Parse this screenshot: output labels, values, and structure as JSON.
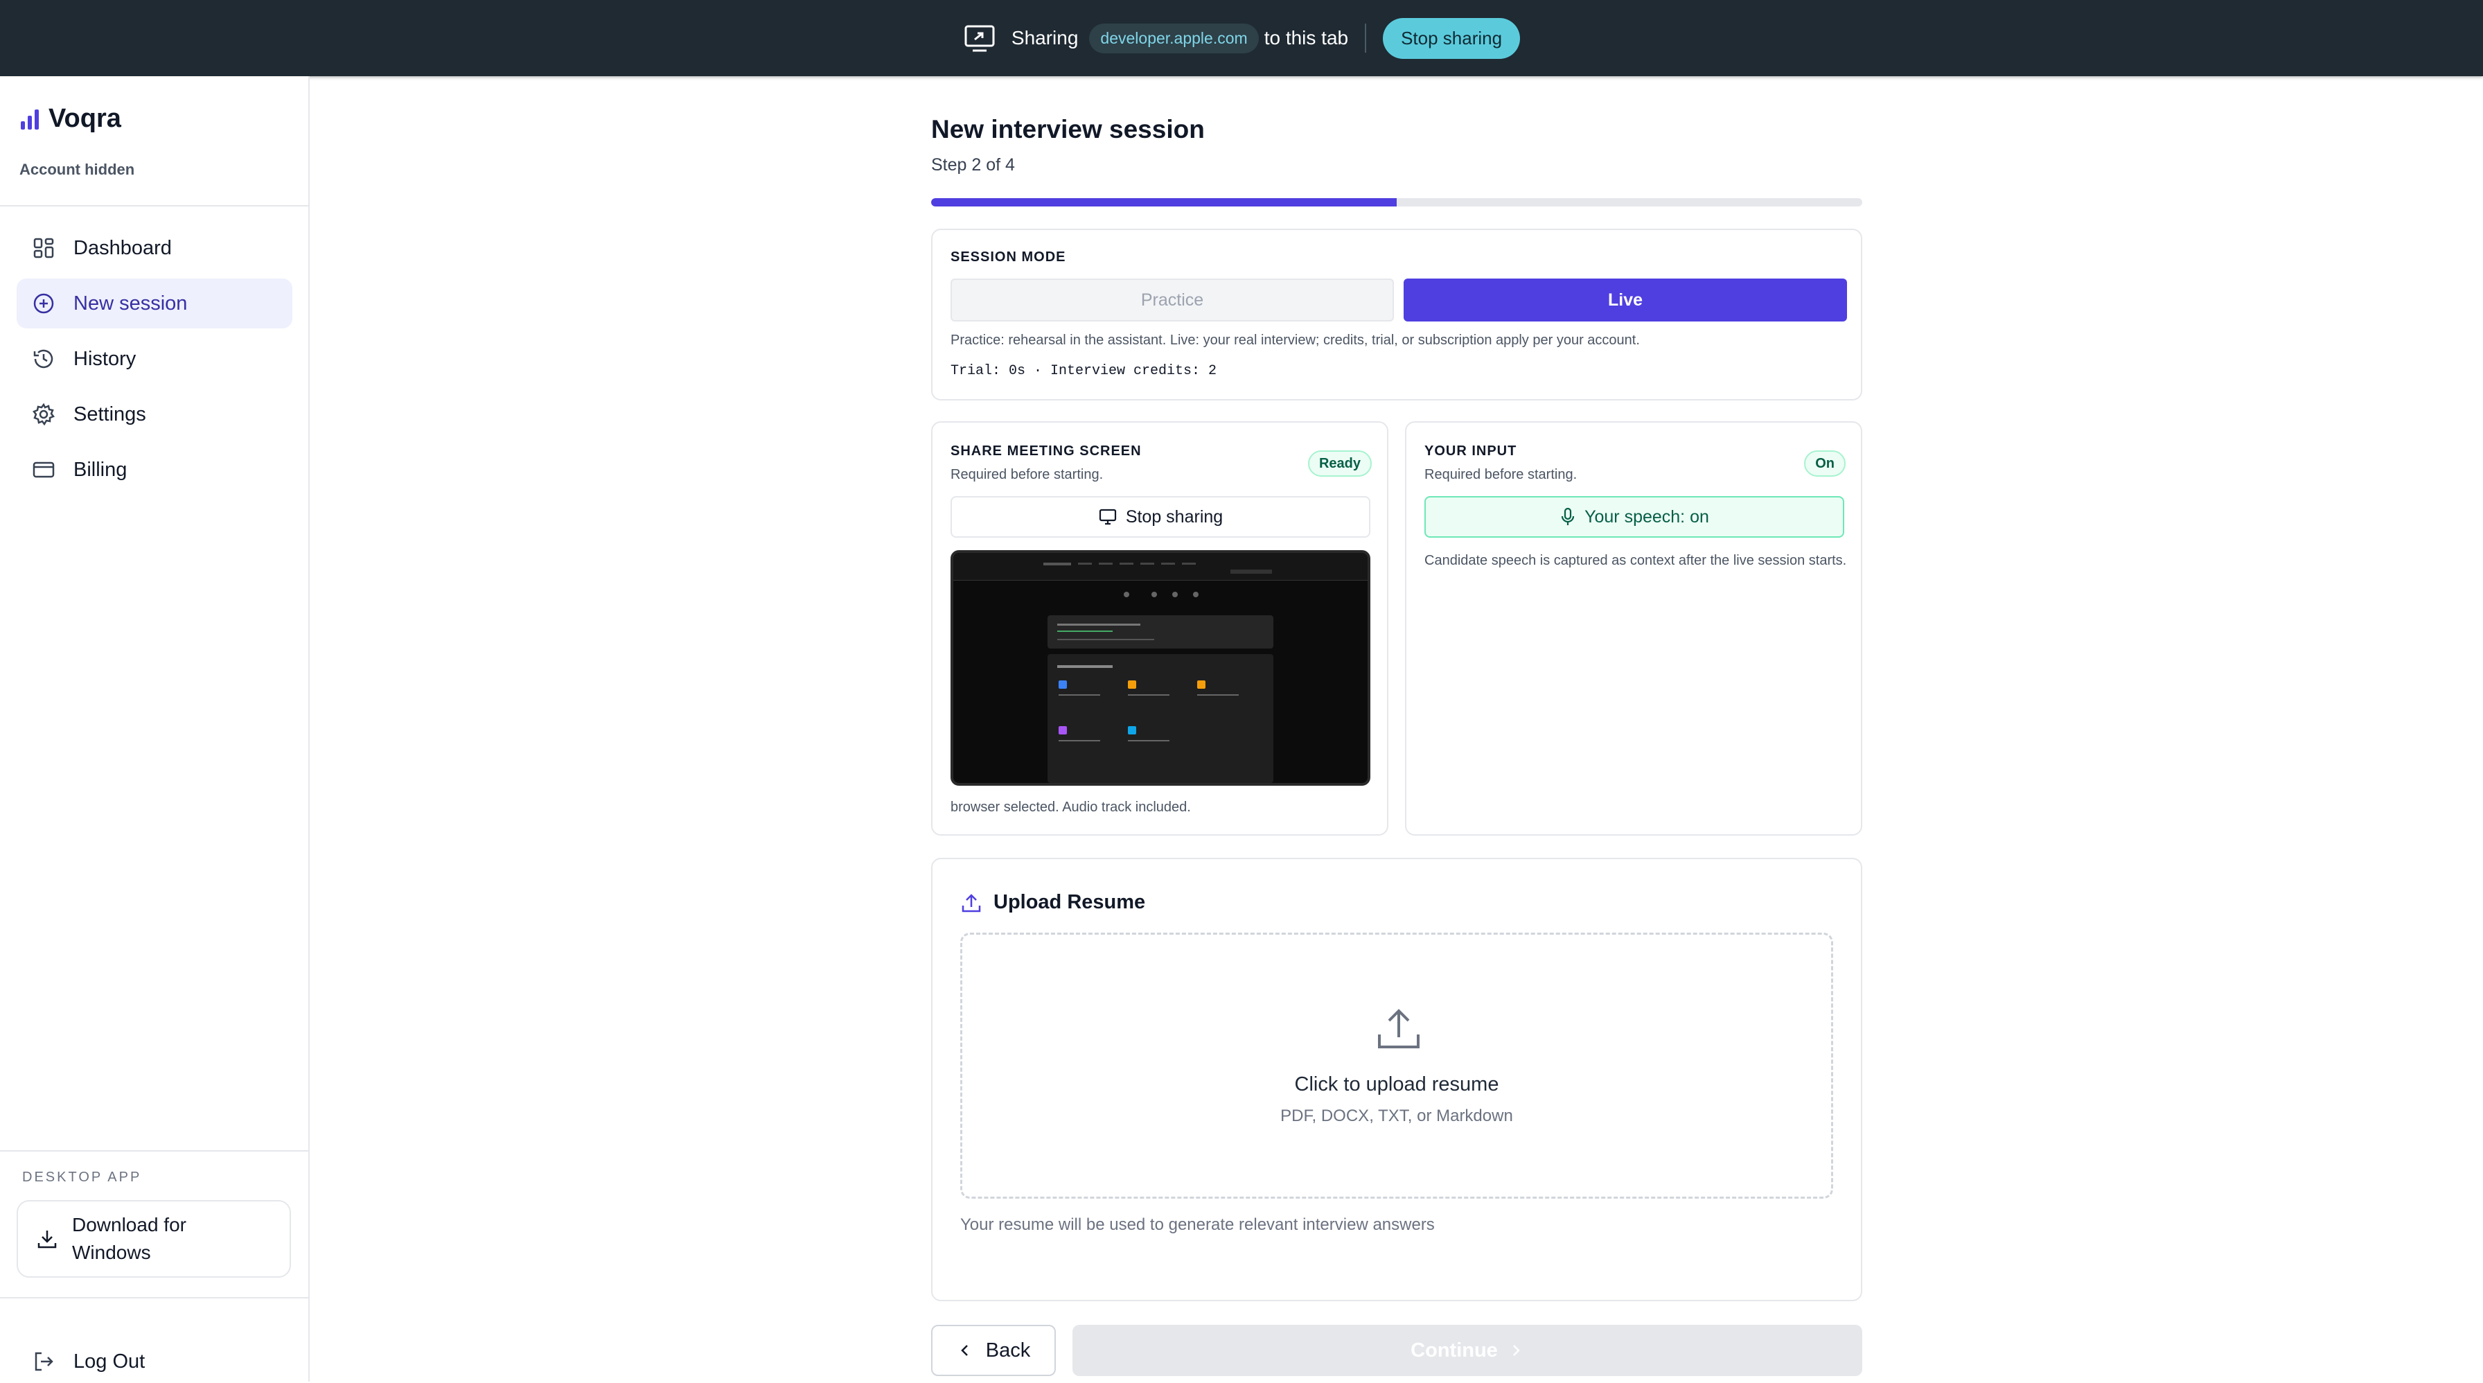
{
  "topbar": {
    "sharing_label": "Sharing",
    "domain": "developer.apple.com",
    "suffix": "to this tab",
    "stop_label": "Stop sharing"
  },
  "sidebar": {
    "brand": "Voqra",
    "account": "Account hidden",
    "items": [
      {
        "label": "Dashboard",
        "icon": "grid-icon"
      },
      {
        "label": "New session",
        "icon": "plus-circle-icon",
        "active": true
      },
      {
        "label": "History",
        "icon": "history-icon"
      },
      {
        "label": "Settings",
        "icon": "gear-icon"
      },
      {
        "label": "Billing",
        "icon": "card-icon"
      }
    ],
    "desktop_label": "DESKTOP APP",
    "download_label_line1": "Download for",
    "download_label_line2": "Windows",
    "logout_label": "Log Out"
  },
  "main": {
    "title": "New interview session",
    "step": "Step 2 of 4",
    "progress": 0.5,
    "mode": {
      "label": "SESSION MODE",
      "practice": "Practice",
      "live": "Live",
      "selected": "Live",
      "help": "Practice: rehearsal in the assistant. Live: your real interview; credits, trial, or subscription apply per your account.",
      "credits": "Trial: 0s · Interview credits: 2"
    },
    "share": {
      "label": "SHARE MEETING SCREEN",
      "desc": "Required before starting.",
      "badge": "Ready",
      "button": "Stop sharing",
      "status": "browser selected. Audio track included."
    },
    "input": {
      "label": "YOUR INPUT",
      "desc": "Required before starting.",
      "badge": "On",
      "button": "Your speech: on",
      "note": "Candidate speech is captured as context after the live session starts."
    },
    "upload": {
      "title": "Upload Resume",
      "drop_title": "Click to upload resume",
      "drop_sub": "PDF, DOCX, TXT, or Markdown",
      "note": "Your resume will be used to generate relevant interview answers"
    },
    "back_label": "Back",
    "continue_label": "Continue"
  },
  "colors": {
    "accent": "#4f3fe0",
    "topbar_bg": "#1f2a33",
    "ready_green": "#065f46"
  }
}
